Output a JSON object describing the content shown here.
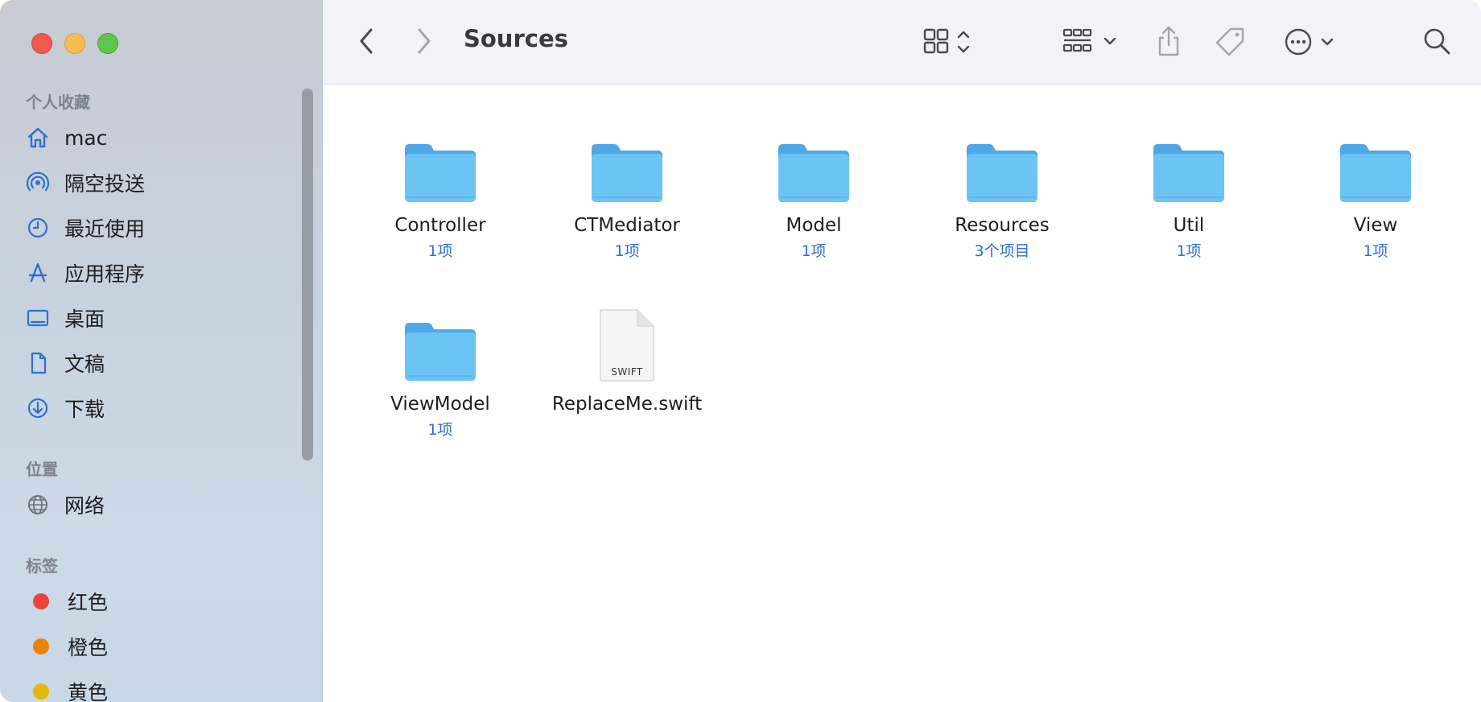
{
  "window": {
    "title": "Sources"
  },
  "sidebar": {
    "sections": [
      {
        "title": "个人收藏",
        "items": [
          {
            "label": "mac",
            "icon": "home-icon"
          },
          {
            "label": "隔空投送",
            "icon": "airdrop-icon"
          },
          {
            "label": "最近使用",
            "icon": "clock-icon"
          },
          {
            "label": "应用程序",
            "icon": "applications-icon"
          },
          {
            "label": "桌面",
            "icon": "desktop-icon"
          },
          {
            "label": "文稿",
            "icon": "document-icon"
          },
          {
            "label": "下载",
            "icon": "download-icon"
          }
        ]
      },
      {
        "title": "位置",
        "items": [
          {
            "label": "网络",
            "icon": "network-globe-icon"
          }
        ]
      },
      {
        "title": "标签",
        "items": [
          {
            "label": "红色",
            "color": "#f0413b"
          },
          {
            "label": "橙色",
            "color": "#e8830c"
          },
          {
            "label": "黄色",
            "color": "#e3b70c"
          }
        ]
      }
    ]
  },
  "toolbar": {
    "icons": [
      "back-icon",
      "forward-icon",
      "grid-view-icon",
      "group-icon",
      "share-icon",
      "tag-icon",
      "more-icon",
      "search-icon"
    ]
  },
  "files": [
    {
      "name": "Controller",
      "sub": "1项",
      "kind": "folder"
    },
    {
      "name": "CTMediator",
      "sub": "1项",
      "kind": "folder"
    },
    {
      "name": "Model",
      "sub": "1项",
      "kind": "folder"
    },
    {
      "name": "Resources",
      "sub": "3个项目",
      "kind": "folder"
    },
    {
      "name": "Util",
      "sub": "1项",
      "kind": "folder"
    },
    {
      "name": "View",
      "sub": "1项",
      "kind": "folder"
    },
    {
      "name": "ViewModel",
      "sub": "1项",
      "kind": "folder"
    },
    {
      "name": "ReplaceMe.swift",
      "sub": "",
      "kind": "file",
      "badge": "SWIFT"
    }
  ],
  "colors": {
    "accent": "#2f6fcd",
    "folder": "#6cc4f5",
    "folder_tab": "#4fa8e6"
  }
}
